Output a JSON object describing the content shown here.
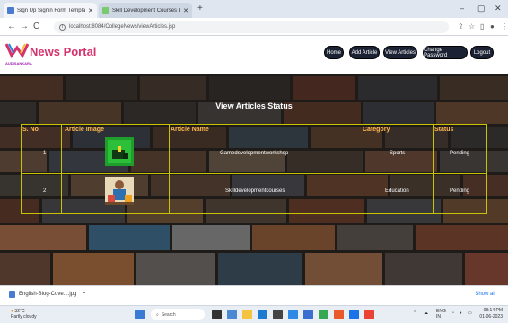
{
  "browser": {
    "tabs": [
      {
        "title": "Sign Up Signin Form Template |",
        "active": true
      },
      {
        "title": "Skill Development Courses List C",
        "active": false
      }
    ],
    "url": "localhost:8084/CollegeNews/viewArticles.jsp",
    "nav": {
      "back": "←",
      "forward": "→",
      "reload": "C"
    },
    "window": {
      "minimize": "–",
      "maximize": "▢",
      "close": "✕"
    }
  },
  "site": {
    "brand": "News Portal",
    "brand_sub": "AUDISANKARA",
    "nav": [
      "Home",
      "Add Article",
      "View Articles",
      "Change Password",
      "Logout"
    ]
  },
  "page": {
    "title": "View Articles Status",
    "columns": [
      "S. No",
      "Article Image",
      "Article Name",
      "Category",
      "Status"
    ],
    "rows": [
      {
        "sno": "1",
        "name": "Gamedevelopmentworkshop",
        "category": "Sports",
        "status": "Pending"
      },
      {
        "sno": "2",
        "name": "Skilldevelopmentcourses",
        "category": "Education",
        "status": "Pending"
      }
    ]
  },
  "downloads": {
    "file": "English-Blog-Cove....jpg",
    "show_all": "Show all"
  },
  "taskbar": {
    "weather_temp": "32°C",
    "weather_desc": "Partly cloudy",
    "search_placeholder": "Search",
    "lang": "ENG",
    "region": "IN",
    "time": "08:14 PM",
    "date": "01-06-2023"
  },
  "colors": {
    "accent": "#d6336c",
    "table_border": "#c8c300",
    "header_text": "#ffb74d",
    "nav_button": "#1b2233"
  }
}
